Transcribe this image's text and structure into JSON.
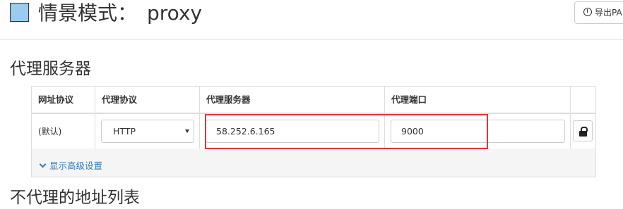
{
  "header": {
    "profile_color": "#99ccee",
    "title_prefix": "情景模式：",
    "profile_name": "proxy",
    "export_label": "导出PA",
    "export_icon": "download-circle-icon"
  },
  "proxy_section": {
    "title": "代理服务器",
    "columns": [
      "网址协议",
      "代理协议",
      "代理服务器",
      "代理端口"
    ],
    "row": {
      "scheme_label": "(默认)",
      "protocol": "HTTP",
      "server": "58.252.6.165",
      "port": "9000",
      "lock_icon": "lock-icon"
    },
    "advanced_label": "显示高级设置",
    "advanced_icon": "chevron-down-icon"
  },
  "bypass_section": {
    "title": "不代理的地址列表"
  },
  "colors": {
    "highlight": "#e3333a",
    "link": "#337ab7"
  }
}
